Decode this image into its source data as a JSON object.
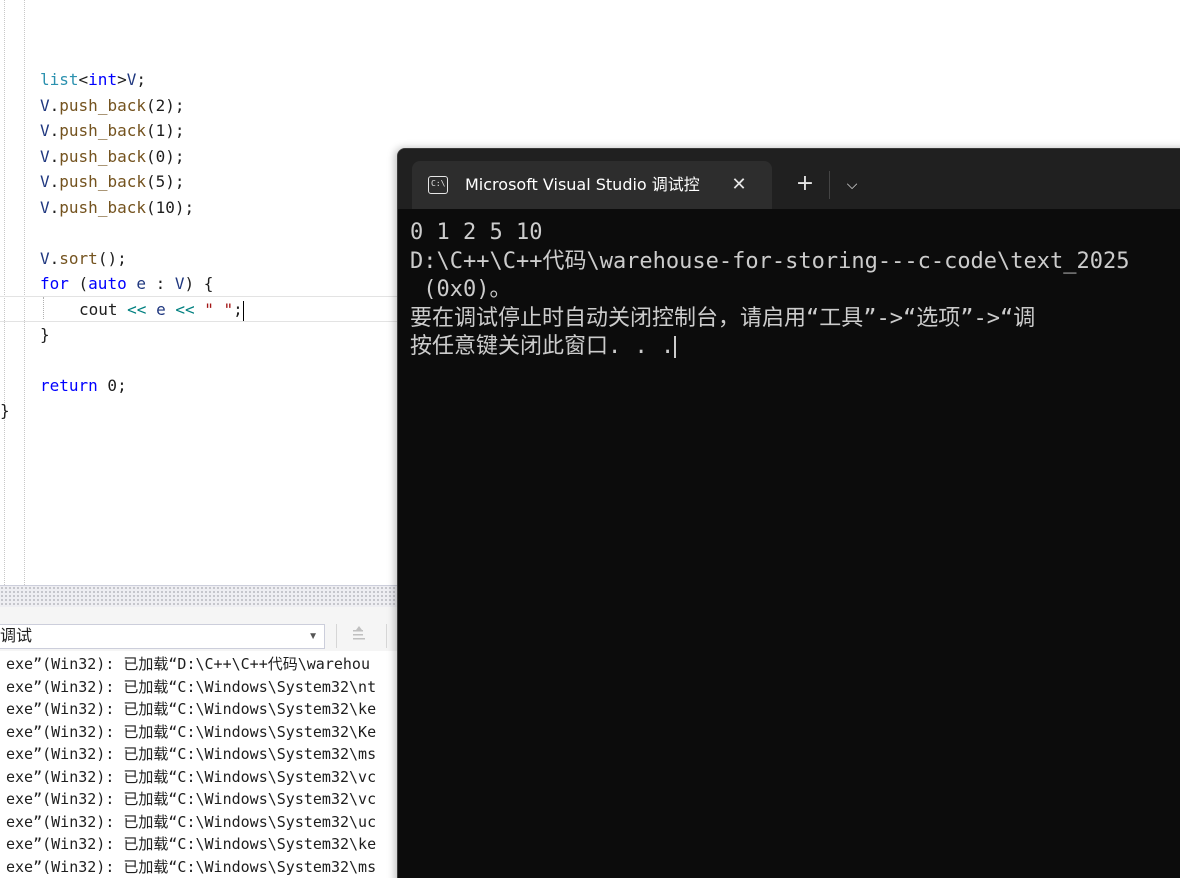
{
  "editor": {
    "lines": {
      "l1_type": "list",
      "l1_open": "<",
      "l1_int": "int",
      "l1_close": ">",
      "l1_var": "V",
      "l1_semi": ";",
      "pb_var": "V",
      "pb_dot": ".",
      "pb_fn": "push_back",
      "pb_args": [
        "(2);",
        "(1);",
        "(0);",
        "(5);",
        "(10);"
      ],
      "sort_var": "V",
      "sort_dot": ".",
      "sort_fn": "sort",
      "sort_args": "();",
      "for_kw": "for",
      "for_open": " (",
      "for_auto": "auto",
      "for_e": " e",
      "for_colon": " : ",
      "for_v": "V",
      "for_close": ") {",
      "cout": "cout",
      "op1": " << ",
      "cout_e": "e",
      "op2": " << ",
      "str": "\" \"",
      "cout_semi": ";",
      "brace_close": "}",
      "return_kw": "return",
      "return_val": " 0;",
      "fn_close": "}"
    }
  },
  "output_pane": {
    "source_select": "调试",
    "log_lines": [
      "exe”(Win32): 已加载“D:\\C++\\C++代码\\warehou",
      "exe”(Win32): 已加载“C:\\Windows\\System32\\nt",
      "exe”(Win32): 已加载“C:\\Windows\\System32\\ke",
      "exe”(Win32): 已加载“C:\\Windows\\System32\\Ke",
      "exe”(Win32): 已加载“C:\\Windows\\System32\\ms",
      "exe”(Win32): 已加载“C:\\Windows\\System32\\vc",
      "exe”(Win32): 已加载“C:\\Windows\\System32\\vc",
      "exe”(Win32): 已加载“C:\\Windows\\System32\\uc",
      "exe”(Win32): 已加载“C:\\Windows\\System32\\ke",
      "exe”(Win32): 已加载“C:\\Windows\\System32\\ms"
    ]
  },
  "terminal": {
    "tab_title": "Microsoft Visual Studio 调试控",
    "tab_icon_glyph": "C:\\",
    "close_glyph": "✕",
    "new_tab_glyph": "+",
    "dropdown_glyph": "⌵",
    "lines": [
      "0 1 2 5 10",
      "D:\\C++\\C++代码\\warehouse-for-storing---c-code\\text_2025",
      " (0x0)。",
      "要在调试停止时自动关闭控制台，请启用“工具”->“选项”->“调",
      "按任意键关闭此窗口. . ."
    ]
  }
}
